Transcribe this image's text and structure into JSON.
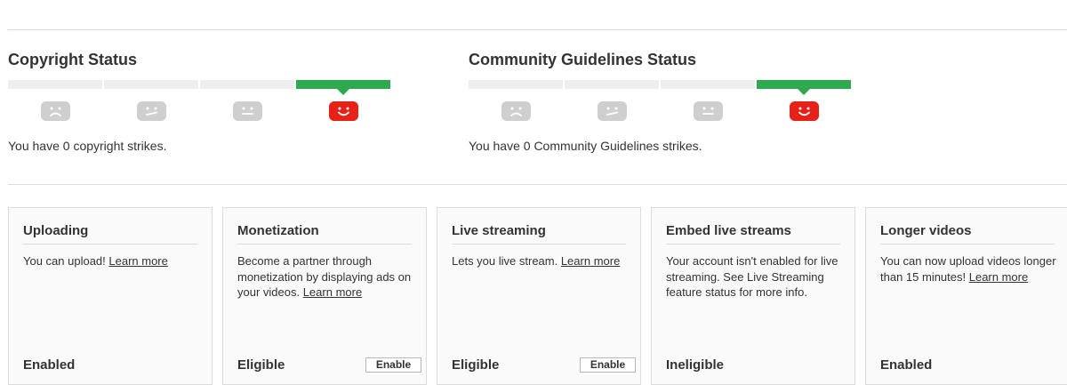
{
  "copyright": {
    "title": "Copyright Status",
    "strikes_text": "You have 0 copyright strikes."
  },
  "community": {
    "title": "Community Guidelines Status",
    "strikes_text": "You have 0 Community Guidelines strikes."
  },
  "meter": {
    "levels": [
      "sad-face-icon",
      "worried-face-icon",
      "neutral-face-icon",
      "happy-face-icon"
    ],
    "active_level": 3,
    "colors": {
      "active_bar": "#2fa84f",
      "active_face": "#e62117",
      "inactive_face": "#cfcfcf",
      "inactive_bar": "#eeeeee"
    }
  },
  "cards": [
    {
      "title": "Uploading",
      "desc": "You can upload! ",
      "link": "Learn more",
      "status": "Enabled"
    },
    {
      "title": "Monetization",
      "desc": "Become a partner through monetization by displaying ads on your videos. ",
      "link": "Learn more",
      "status": "Eligible",
      "button": "Enable"
    },
    {
      "title": "Live streaming",
      "desc": "Lets you live stream. ",
      "link": "Learn more",
      "status": "Eligible",
      "button": "Enable"
    },
    {
      "title": "Embed live streams",
      "desc": "Your account isn't enabled for live streaming. See Live Streaming feature status for more info.",
      "status": "Ineligible"
    },
    {
      "title": "Longer videos",
      "desc": "You can now upload videos longer than 15 minutes! ",
      "link": "Learn more",
      "status": "Enabled"
    }
  ]
}
